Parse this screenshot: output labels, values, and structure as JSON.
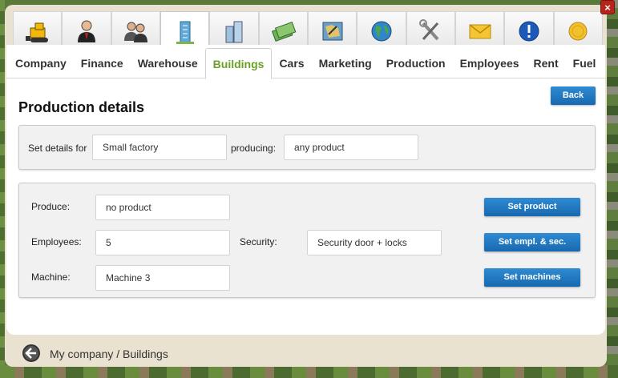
{
  "icon_tabs": [
    {
      "name": "bulldozer-icon",
      "active": false
    },
    {
      "name": "businessman-icon",
      "active": false
    },
    {
      "name": "people-icon",
      "active": false
    },
    {
      "name": "building-icon",
      "active": true
    },
    {
      "name": "office-buildings-icon",
      "active": false
    },
    {
      "name": "money-bills-icon",
      "active": false
    },
    {
      "name": "map-icon",
      "active": false
    },
    {
      "name": "globe-icon",
      "active": false
    },
    {
      "name": "tools-icon",
      "active": false
    },
    {
      "name": "envelope-icon",
      "active": false
    },
    {
      "name": "info-exclamation-icon",
      "active": false
    },
    {
      "name": "coin-icon",
      "active": false
    }
  ],
  "tabs": [
    {
      "label": "Company"
    },
    {
      "label": "Finance"
    },
    {
      "label": "Warehouse"
    },
    {
      "label": "Buildings"
    },
    {
      "label": "Cars"
    },
    {
      "label": "Marketing"
    },
    {
      "label": "Production"
    },
    {
      "label": "Employees"
    },
    {
      "label": "Rent"
    },
    {
      "label": "Fuel"
    }
  ],
  "active_tab": "Buildings",
  "page": {
    "title": "Production details",
    "back_label": "Back"
  },
  "set_details": {
    "label": "Set details for",
    "building_value": "Small factory",
    "producing_label": "producing:",
    "product_value": "any product"
  },
  "form": {
    "produce_label": "Produce:",
    "produce_value": "no product",
    "employees_label": "Employees:",
    "employees_value": "5",
    "security_label": "Security:",
    "security_value": "Security door + locks",
    "machine_label": "Machine:",
    "machine_value": "Machine 3",
    "set_product_label": "Set product",
    "set_empl_label": "Set empl. & sec.",
    "set_machines_label": "Set machines"
  },
  "close_label": "×",
  "breadcrumb": "My company / Buildings",
  "colors": {
    "accent_green": "#6aa125",
    "button_blue": "#1e78c2",
    "close_red": "#b8231c"
  }
}
